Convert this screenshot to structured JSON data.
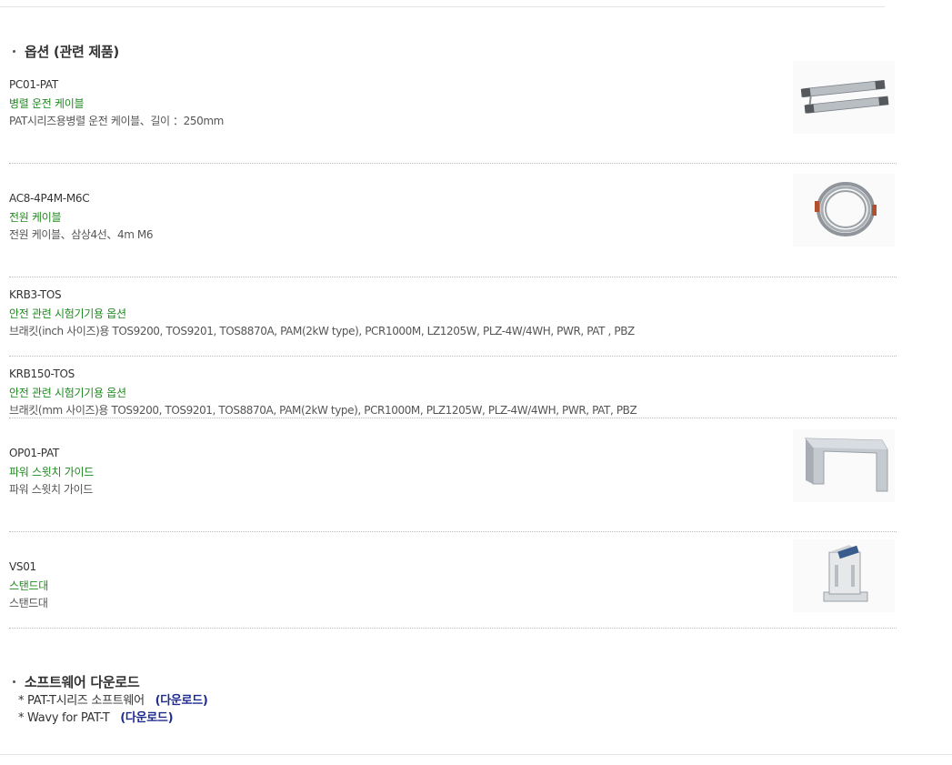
{
  "options": {
    "title": "옵션 (관련 제품)",
    "products": [
      {
        "code": "PC01-PAT",
        "name": "병렬 운전 케이블",
        "desc": "PAT시리즈용병렬 운전 케이블、길이 ：250mm",
        "image": "ribbon-cable"
      },
      {
        "code": "AC8-4P4M-M6C",
        "name": "전원 케이블",
        "desc": "전원 케이블、삼상4선、4m M6",
        "image": "coiled-cable"
      },
      {
        "code": "KRB3-TOS",
        "name": "안전 관련 시험기기용 옵션",
        "desc": "브래킷(inch 사이즈)용 TOS9200, TOS9201, TOS8870A, PAM(2kW type), PCR1000M, LZ1205W, PLZ-4W/4WH, PWR, PAT , PBZ"
      },
      {
        "code": "KRB150-TOS",
        "name": "안전 관련 시험기기용 옵션",
        "desc": "브래킷(mm 사이즈)용 TOS9200, TOS9201, TOS8870A, PAM(2kW type), PCR1000M, PLZ1205W, PLZ-4W/4WH, PWR, PAT, PBZ"
      },
      {
        "code": "OP01-PAT",
        "name": "파워 스윗치 가이드",
        "desc": "파워 스윗치 가이드",
        "image": "switch-guide"
      },
      {
        "code": "VS01",
        "name": "스탠드대",
        "desc": "스탠드대",
        "image": "stand"
      }
    ]
  },
  "software": {
    "title": "소프트웨어 다운로드",
    "items": [
      {
        "label": "* PAT-T시리즈 소프트웨어",
        "link": "(다운로드)"
      },
      {
        "label": "* Wavy for PAT-T",
        "link": "(다운로드)"
      }
    ]
  },
  "colors": {
    "name_green": "#1f8a1f",
    "link_blue": "#1d2a8f",
    "divider": "#bbbbbb"
  }
}
